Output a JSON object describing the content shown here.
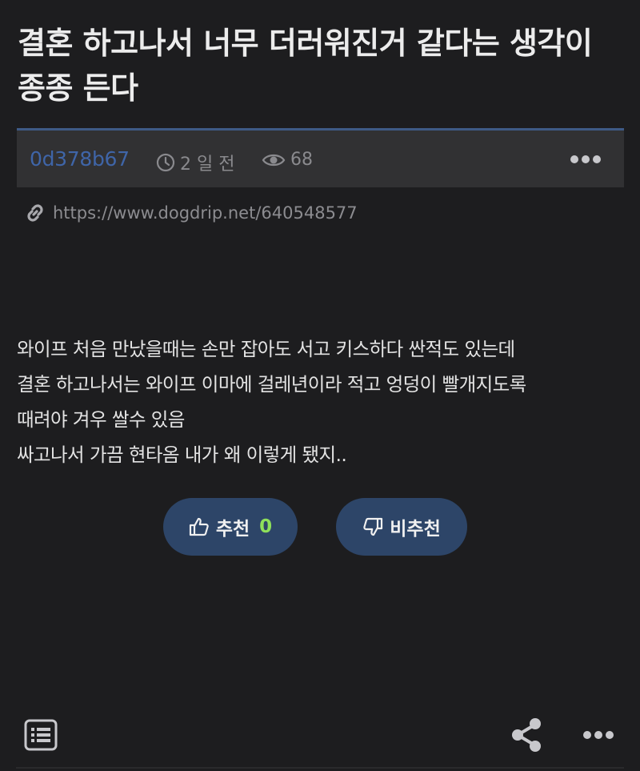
{
  "post": {
    "title": "결혼 하고나서 너무 더러워진거 같다는 생각이 종종 든다",
    "author": "0d378b67",
    "date": "2 일 전",
    "views": "68",
    "url": "https://www.dogdrip.net/640548577",
    "body_lines": [
      "와이프 처음 만났을때는 손만 잡아도 서고 키스하다 싼적도 있는데",
      "결혼 하고나서는 와이프 이마에 걸레년이라 적고 엉덩이 빨개지도록",
      "때려야 겨우 쌀수 있음",
      "싸고나서 가끔 현타옴 내가 왜 이렇게 됐지.."
    ]
  },
  "votes": {
    "upvote_label": "추천",
    "upvote_count": "0",
    "downvote_label": "비추천"
  },
  "icons": {
    "clock": "clock-icon",
    "eye": "eye-icon",
    "more": "more-icon",
    "link": "link-icon",
    "thumbs_up": "thumbs-up-icon",
    "thumbs_down": "thumbs-down-icon",
    "list": "list-icon",
    "share": "share-icon"
  },
  "colors": {
    "background": "#1d1d1f",
    "meta_bar": "#313133",
    "accent_border": "#3e5a86",
    "author": "#3f65a8",
    "vote_button": "#2d4568",
    "upvote_count": "#8ee05a"
  }
}
